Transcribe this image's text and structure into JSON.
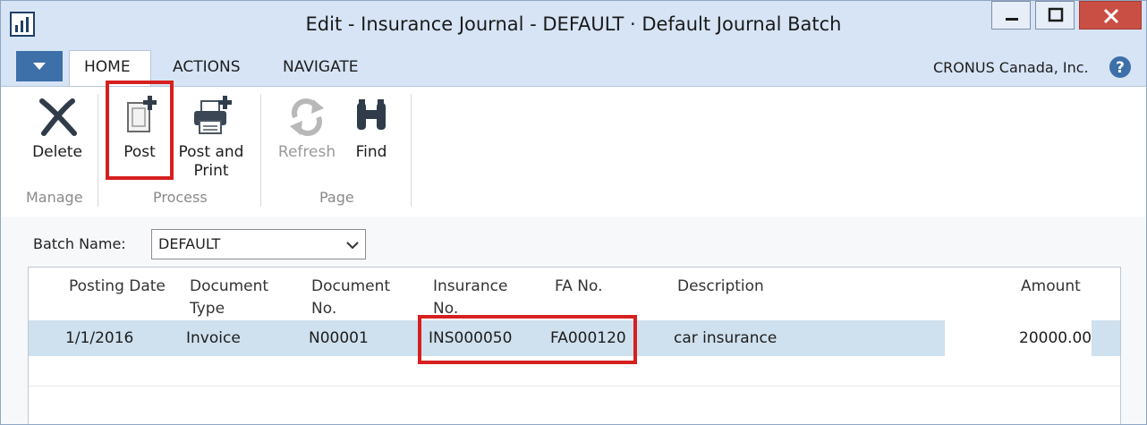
{
  "window": {
    "title": "Edit - Insurance Journal - DEFAULT · Default Journal Batch"
  },
  "tabs": [
    {
      "label": "HOME",
      "active": true
    },
    {
      "label": "ACTIONS",
      "active": false
    },
    {
      "label": "NAVIGATE",
      "active": false
    }
  ],
  "company": "CRONUS Canada, Inc.",
  "ribbon": {
    "buttons": {
      "delete": {
        "label": "Delete",
        "icon": "x-icon"
      },
      "post": {
        "label": "Post",
        "icon": "post-document-icon"
      },
      "post_print_line1": "Post and",
      "post_print_line2": "Print",
      "refresh": {
        "label": "Refresh",
        "icon": "refresh-icon",
        "disabled": true
      },
      "find": {
        "label": "Find",
        "icon": "binoculars-icon"
      }
    },
    "groups": {
      "manage": "Manage",
      "process": "Process",
      "page": "Page"
    }
  },
  "batch": {
    "label": "Batch Name:",
    "value": "DEFAULT"
  },
  "columns": {
    "posting_date": "Posting Date",
    "doc_type_1": "Document",
    "doc_type_2": "Type",
    "doc_no_1": "Document",
    "doc_no_2": "No.",
    "ins_no_1": "Insurance",
    "ins_no_2": "No.",
    "fa_no": "FA No.",
    "description": "Description",
    "amount": "Amount"
  },
  "rows": [
    {
      "posting_date": "1/1/2016",
      "document_type": "Invoice",
      "document_no": "N00001",
      "insurance_no": "INS000050",
      "fa_no": "FA000120",
      "description": "car insurance",
      "amount": "20000.00"
    }
  ],
  "colors": {
    "accent": "#3d6fa8",
    "highlight": "#d62020",
    "selected_row": "#cfe0ee",
    "titlebar": "#d6e4f5"
  }
}
